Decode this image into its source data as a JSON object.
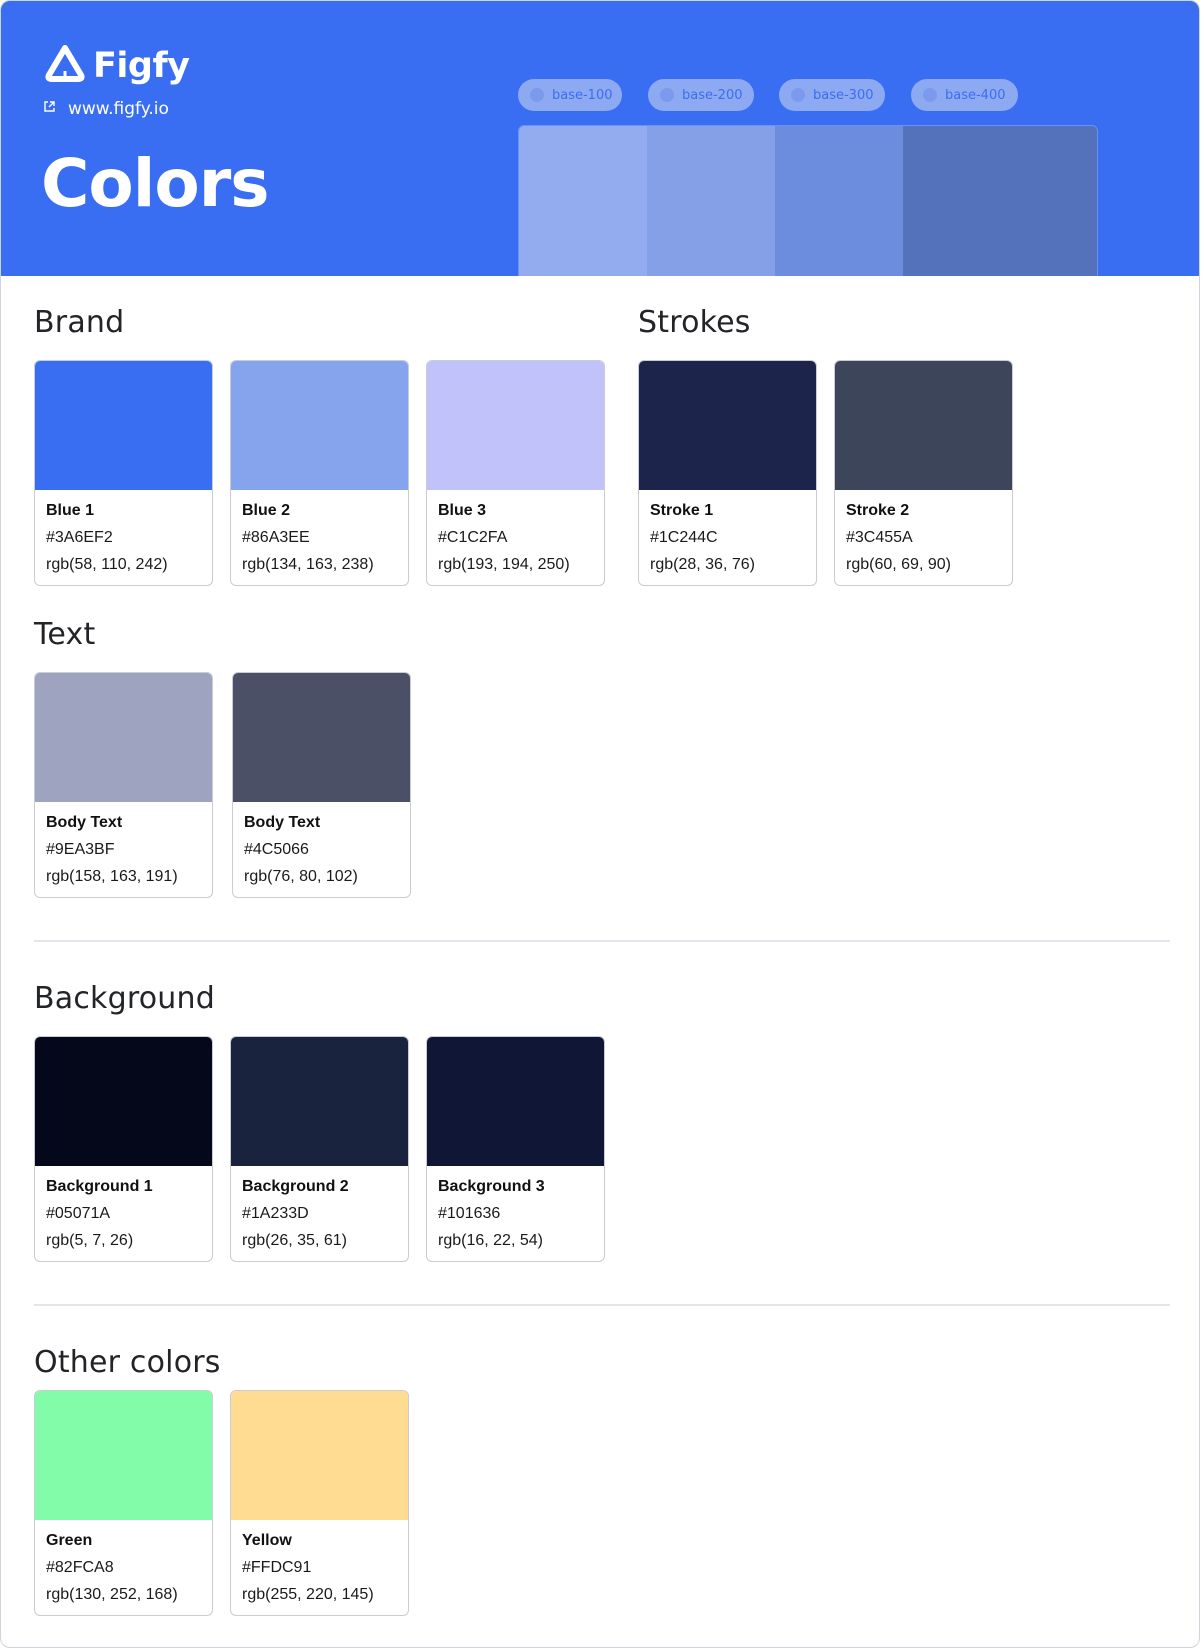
{
  "header": {
    "logo_text": "Figfy",
    "site_link": "www.figfy.io",
    "title": "Colors",
    "accent": "#3A6EF2",
    "pills": [
      {
        "label": "base-100"
      },
      {
        "label": "base-200"
      },
      {
        "label": "base-300"
      },
      {
        "label": "base-400"
      }
    ],
    "scale_colors": [
      "#93ACEF",
      "#86A0E7",
      "#6C8CDE",
      "#5472BB"
    ]
  },
  "sections": {
    "brand": {
      "title": "Brand",
      "cards": [
        {
          "name": "Blue 1",
          "hex": "#3A6EF2",
          "rgb": "rgb(58, 110, 242)",
          "color": "#3A6EF2"
        },
        {
          "name": "Blue 2",
          "hex": "#86A3EE",
          "rgb": "rgb(134, 163, 238)",
          "color": "#86A3EE"
        },
        {
          "name": "Blue 3",
          "hex": "#C1C2FA",
          "rgb": "rgb(193, 194, 250)",
          "color": "#C1C2FA"
        }
      ]
    },
    "strokes": {
      "title": "Strokes",
      "cards": [
        {
          "name": "Stroke 1",
          "hex": "#1C244C",
          "rgb": "rgb(28, 36, 76)",
          "color": "#1C244C"
        },
        {
          "name": "Stroke 2",
          "hex": "#3C455A",
          "rgb": "rgb(60, 69, 90)",
          "color": "#3C455A"
        }
      ]
    },
    "text": {
      "title": "Text",
      "cards": [
        {
          "name": "Body Text",
          "hex": "#9EA3BF",
          "rgb": "rgb(158, 163, 191)",
          "color": "#9EA3BF"
        },
        {
          "name": "Body Text",
          "hex": "#4C5066",
          "rgb": "rgb(76, 80, 102)",
          "color": "#4C5066"
        }
      ]
    },
    "background": {
      "title": "Background",
      "cards": [
        {
          "name": "Background 1",
          "hex": "#05071A",
          "rgb": "rgb(5, 7, 26)",
          "color": "#05071A"
        },
        {
          "name": "Background 2",
          "hex": "#1A233D",
          "rgb": "rgb(26, 35, 61)",
          "color": "#1A233D"
        },
        {
          "name": "Background 3",
          "hex": "#101636",
          "rgb": "rgb(16, 22, 54)",
          "color": "#101636"
        }
      ]
    },
    "other": {
      "title": "Other colors",
      "cards": [
        {
          "name": "Green",
          "hex": "#82FCA8",
          "rgb": "rgb(130, 252, 168)",
          "color": "#82FCA8"
        },
        {
          "name": "Yellow",
          "hex": "#FFDC91",
          "rgb": "rgb(255, 220, 145)",
          "color": "#FFDC91"
        }
      ]
    }
  }
}
